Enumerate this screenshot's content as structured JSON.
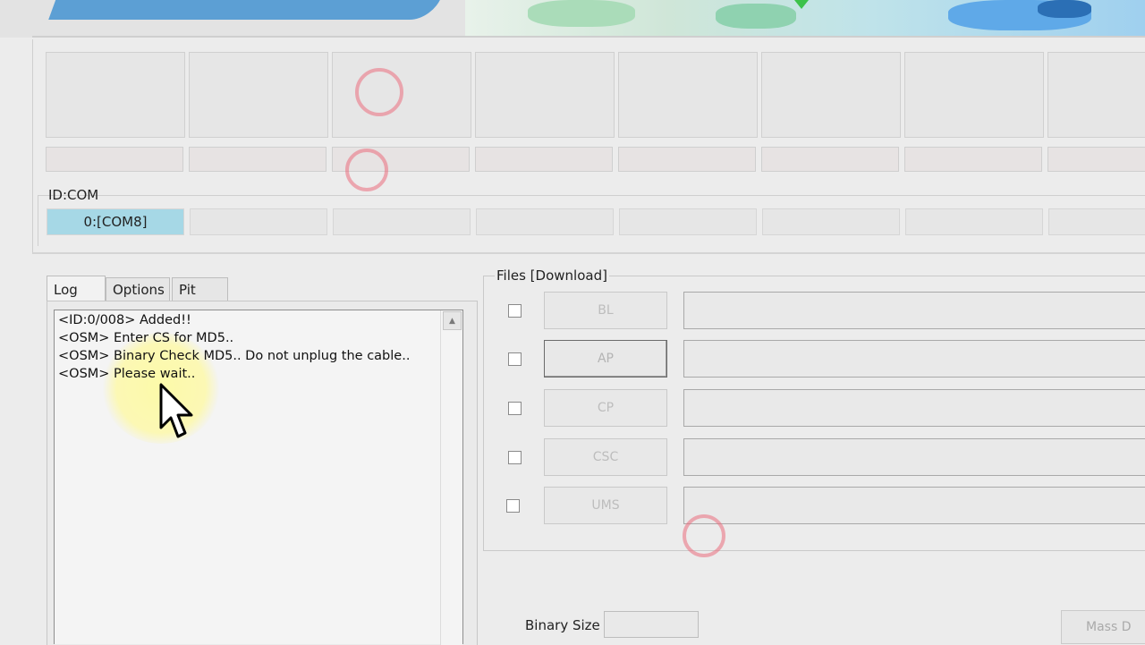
{
  "ports": {
    "idcom_label": "ID:COM",
    "com_cells": [
      "0:[COM8]",
      "",
      "",
      "",
      "",
      "",
      "",
      ""
    ]
  },
  "tabs": [
    {
      "label": "Log",
      "active": true
    },
    {
      "label": "Options",
      "active": false
    },
    {
      "label": "Pit",
      "active": false
    }
  ],
  "log": {
    "lines": [
      "<ID:0/008> Added!!",
      "<OSM> Enter CS for MD5..",
      "<OSM> Binary Check MD5.. Do not unplug the cable..",
      "<OSM> Please wait.."
    ]
  },
  "files": {
    "group_label": "Files [Download]",
    "rows": [
      {
        "button": "BL",
        "checked": false,
        "path": ""
      },
      {
        "button": "AP",
        "checked": false,
        "path": ""
      },
      {
        "button": "CP",
        "checked": false,
        "path": ""
      },
      {
        "button": "CSC",
        "checked": false,
        "path": ""
      },
      {
        "button": "UMS",
        "checked": false,
        "path": ""
      }
    ]
  },
  "footer": {
    "binary_size_label": "Binary Size",
    "binary_size_value": "",
    "mass_button_label": "Mass D"
  },
  "icons": [
    "mouse-cursor-icon",
    "scroll-up-arrow-icon"
  ],
  "colors": {
    "active_com": "#a6d8e6",
    "cursor_highlight": "#fff23c",
    "click_ring": "#eb6e7d"
  }
}
